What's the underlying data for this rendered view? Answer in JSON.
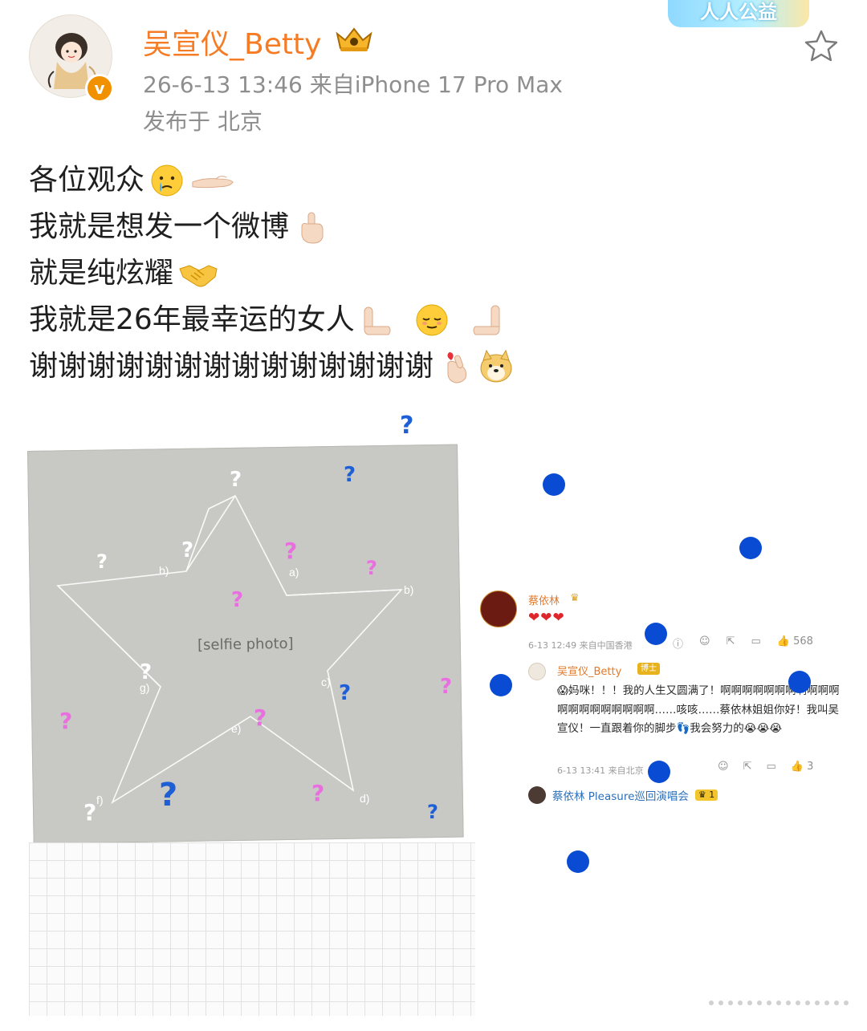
{
  "header": {
    "username": "吴宣仪_Betty",
    "meta": "26-6-13 13:46  来自iPhone 17 Pro Max",
    "location": "发布于 北京",
    "campaign_badge": "人人公益",
    "verified_badge": "v"
  },
  "post": {
    "lines": [
      {
        "text": "各位观众",
        "emojis": [
          "crying-face-icon",
          "palm-up-hand-icon"
        ]
      },
      {
        "text": "我就是想发一个微博",
        "emojis": [
          "index-pointing-up-icon"
        ]
      },
      {
        "text": "就是纯炫耀",
        "emojis": [
          "handshake-icon"
        ]
      },
      {
        "text": "我就是26年最幸运的女人",
        "emojis": [
          "leftwards-hand-icon",
          "relieved-face-icon",
          "rightwards-hand-icon"
        ]
      },
      {
        "text": "谢谢谢谢谢谢谢谢谢谢谢谢谢谢",
        "emojis": [
          "finger-heart-icon",
          "doge-icon"
        ]
      }
    ]
  },
  "comment": {
    "name1": "蔡依林",
    "crown1": "♛",
    "hearts": "❤❤❤",
    "meta1": "6-13 12:49  来自中国香港",
    "likes1": "568",
    "reply_name": "吴宣仪_Betty",
    "reply_badge": "博士",
    "reply_text": "😱妈咪！！！我的人生又圆满了！啊啊啊啊啊啊啊啊啊啊啊啊啊啊啊啊啊啊啊啊……咳咳……蔡依林姐姐你好！我叫吴宣仪！一直跟着你的脚步👣我会努力的😭😭😭",
    "meta2": "6-13 13:41  来自北京",
    "likes2": "3",
    "sub_name": "蔡依林 Pleasure巡回演唱会",
    "sub_badge": "♛ 1"
  },
  "annotations": [
    "a)",
    "b)",
    "b)",
    "c)",
    "d)",
    "e)",
    "f)",
    "g)"
  ],
  "colors": {
    "username": "#f57c24",
    "meta": "#8e8e8e",
    "question_blue": "#1f5fd6",
    "question_pink": "#e96fe0",
    "dot_blue": "#0a4bd4"
  }
}
